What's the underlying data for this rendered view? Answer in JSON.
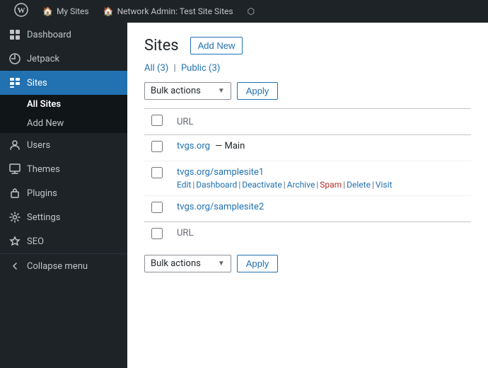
{
  "adminBar": {
    "wpIcon": "⊞",
    "items": [
      {
        "label": "My Sites",
        "icon": "🏠"
      },
      {
        "label": "Network Admin: Test Site Sites",
        "icon": "🏠"
      },
      {
        "label": "",
        "icon": "⬡"
      }
    ]
  },
  "sidebar": {
    "items": [
      {
        "id": "dashboard",
        "label": "Dashboard",
        "icon": "⊞",
        "active": false
      },
      {
        "id": "jetpack",
        "label": "Jetpack",
        "icon": "◑",
        "active": false
      },
      {
        "id": "sites",
        "label": "Sites",
        "icon": "▦",
        "active": true
      },
      {
        "id": "users",
        "label": "Users",
        "icon": "👤",
        "active": false
      },
      {
        "id": "themes",
        "label": "Themes",
        "icon": "🎨",
        "active": false
      },
      {
        "id": "plugins",
        "label": "Plugins",
        "icon": "⚙",
        "active": false
      },
      {
        "id": "settings",
        "label": "Settings",
        "icon": "⚙",
        "active": false
      },
      {
        "id": "seo",
        "label": "SEO",
        "icon": "◈",
        "active": false
      }
    ],
    "submenu": {
      "parentId": "sites",
      "items": [
        {
          "label": "All Sites",
          "active": true
        },
        {
          "label": "Add New",
          "active": false
        }
      ]
    },
    "collapseLabel": "Collapse menu"
  },
  "content": {
    "pageTitle": "Sites",
    "addNewLabel": "Add New",
    "filterLinks": [
      {
        "label": "All",
        "count": "3",
        "active": true
      },
      {
        "label": "Public",
        "count": "3",
        "active": false
      }
    ],
    "bulkActions": {
      "placeholder": "Bulk actions",
      "applyLabel": "Apply"
    },
    "tableHeader": {
      "urlLabel": "URL"
    },
    "sites": [
      {
        "id": 1,
        "url": "tvgs.org",
        "suffix": "— Main",
        "hasActions": false
      },
      {
        "id": 2,
        "url": "tvgs.org/samplesite1",
        "suffix": "",
        "hasActions": true,
        "actions": [
          "Edit",
          "Dashboard",
          "Deactivate",
          "Archive",
          "Spam",
          "Delete",
          "Visit"
        ],
        "spamAction": "Spam"
      },
      {
        "id": 3,
        "url": "tvgs.org/samplesite2",
        "suffix": "",
        "hasActions": false
      }
    ],
    "footerBulkActions": {
      "placeholder": "Bulk actions",
      "applyLabel": "Apply"
    },
    "footerUrlLabel": "URL"
  }
}
